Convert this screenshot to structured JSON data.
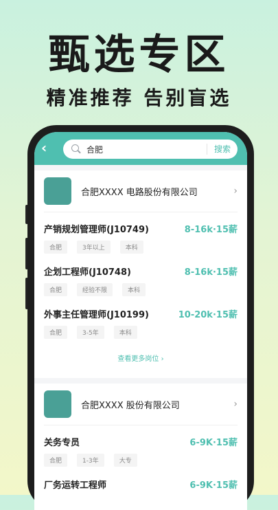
{
  "hero": {
    "headline": "甄选专区",
    "subline": "精准推荐  告别盲选"
  },
  "app": {
    "back_icon": "chevron-left-icon",
    "search": {
      "value": "合肥",
      "button_label": "搜索",
      "icon": "search-icon"
    }
  },
  "companies": [
    {
      "name": "合肥XXXX 电路股份有限公司",
      "jobs": [
        {
          "title": "产销规划管理师(J10749)",
          "salary": "8-16k·15薪",
          "tags": [
            "合肥",
            "3年以上",
            "本科"
          ]
        },
        {
          "title": "企划工程师(J10748)",
          "salary": "8-16k·15薪",
          "tags": [
            "合肥",
            "经验不限",
            "本科"
          ]
        },
        {
          "title": "外事主任管理师(J10199)",
          "salary": "10-20k·15薪",
          "tags": [
            "合肥",
            "3-5年",
            "本科"
          ]
        }
      ],
      "more_label": "查看更多岗位"
    },
    {
      "name": "合肥XXXX 股份有限公司",
      "jobs": [
        {
          "title": "关务专员",
          "salary": "6-9K·15薪",
          "tags": [
            "合肥",
            "1-3年",
            "大专"
          ]
        },
        {
          "title": "厂务运转工程师",
          "salary": "6-9K·15薪",
          "tags": []
        }
      ]
    }
  ],
  "colors": {
    "accent": "#4fbfb0",
    "logo": "#4aa096"
  }
}
